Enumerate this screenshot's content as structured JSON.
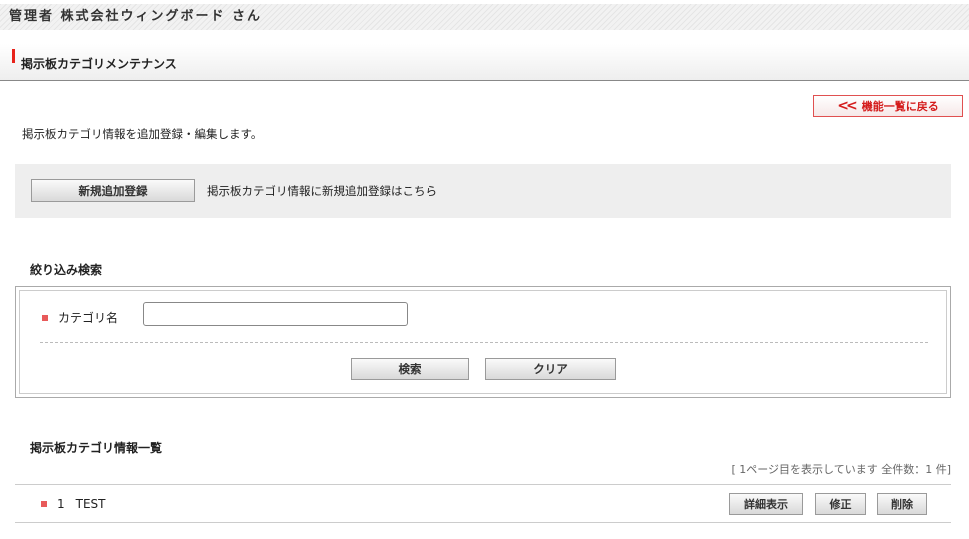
{
  "user_bar": {
    "text": "管理者 株式会社ウィングボード さん"
  },
  "page_header": {
    "title": "掲示板カテゴリメンテナンス"
  },
  "back_button": {
    "chevron": "<<",
    "label": "機能一覧に戻る"
  },
  "intro_text": "掲示板カテゴリ情報を追加登録・編集します。",
  "add_panel": {
    "button_label": "新規追加登録",
    "note": "掲示板カテゴリ情報に新規追加登録はこちら"
  },
  "search": {
    "title": "絞り込み検索",
    "field_label": "カテゴリ名",
    "field_value": "",
    "search_label": "検索",
    "clear_label": "クリア"
  },
  "list": {
    "title": "掲示板カテゴリ情報一覧",
    "page_info": "[ 1ページ目を表示しています 全件数：1 件]",
    "rows": [
      {
        "number": "1",
        "name": "TEST"
      }
    ],
    "detail_label": "詳細表示",
    "edit_label": "修正",
    "delete_label": "削除"
  },
  "colors": {
    "accent": "#e8231b",
    "bullet": "#e85a5a"
  }
}
